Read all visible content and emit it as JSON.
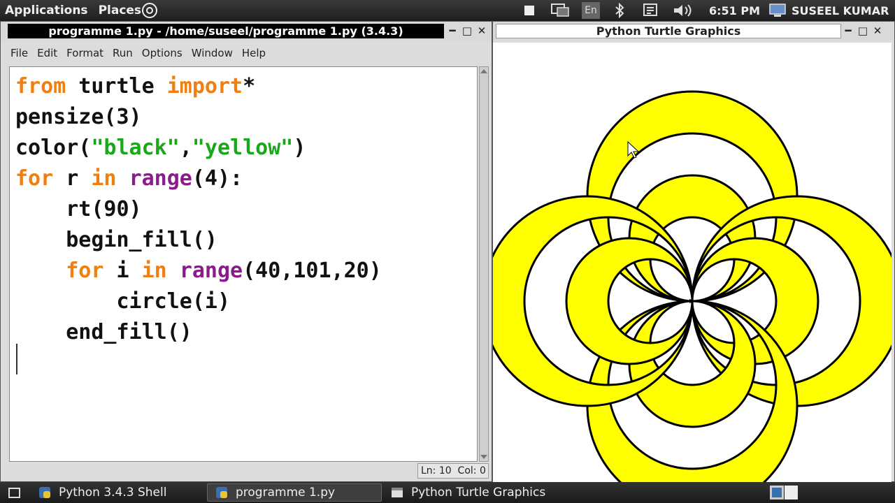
{
  "top_panel": {
    "menus": [
      "Applications",
      "Places"
    ],
    "keyboard_layout": "En",
    "clock": "6:51 PM",
    "user": "SUSEEL KUMAR"
  },
  "editor": {
    "title": "programme 1.py - /home/suseel/programme 1.py (3.4.3)",
    "menu": [
      "File",
      "Edit",
      "Format",
      "Run",
      "Options",
      "Window",
      "Help"
    ],
    "code_lines": [
      [
        {
          "t": "from",
          "c": "kw"
        },
        {
          "t": " turtle ",
          "c": ""
        },
        {
          "t": "import",
          "c": "kw"
        },
        {
          "t": "*",
          "c": ""
        }
      ],
      [
        {
          "t": "pensize(3)",
          "c": ""
        }
      ],
      [
        {
          "t": "color(",
          "c": ""
        },
        {
          "t": "\"black\"",
          "c": "str"
        },
        {
          "t": ",",
          "c": ""
        },
        {
          "t": "\"yellow\"",
          "c": "str"
        },
        {
          "t": ")",
          "c": ""
        }
      ],
      [
        {
          "t": "for",
          "c": "kw"
        },
        {
          "t": " r ",
          "c": ""
        },
        {
          "t": "in",
          "c": "kw"
        },
        {
          "t": " ",
          "c": ""
        },
        {
          "t": "range",
          "c": "bi"
        },
        {
          "t": "(4):",
          "c": ""
        }
      ],
      [
        {
          "t": "    rt(90)",
          "c": ""
        }
      ],
      [
        {
          "t": "    begin_fill()",
          "c": ""
        }
      ],
      [
        {
          "t": "    ",
          "c": ""
        },
        {
          "t": "for",
          "c": "kw"
        },
        {
          "t": " i ",
          "c": ""
        },
        {
          "t": "in",
          "c": "kw"
        },
        {
          "t": " ",
          "c": ""
        },
        {
          "t": "range",
          "c": "bi"
        },
        {
          "t": "(40,101,20)",
          "c": ""
        }
      ],
      [
        {
          "t": "        circle(i)",
          "c": ""
        }
      ],
      [
        {
          "t": "    end_fill()",
          "c": ""
        }
      ]
    ],
    "status": "Ln: 10  Col: 0"
  },
  "turtle_window": {
    "title": "Python Turtle Graphics",
    "fill_color": "#ffff00",
    "pen_color": "#000000"
  },
  "taskbar": {
    "items": [
      "Python 3.4.3 Shell",
      "programme 1.py",
      "Python Turtle Graphics"
    ]
  }
}
